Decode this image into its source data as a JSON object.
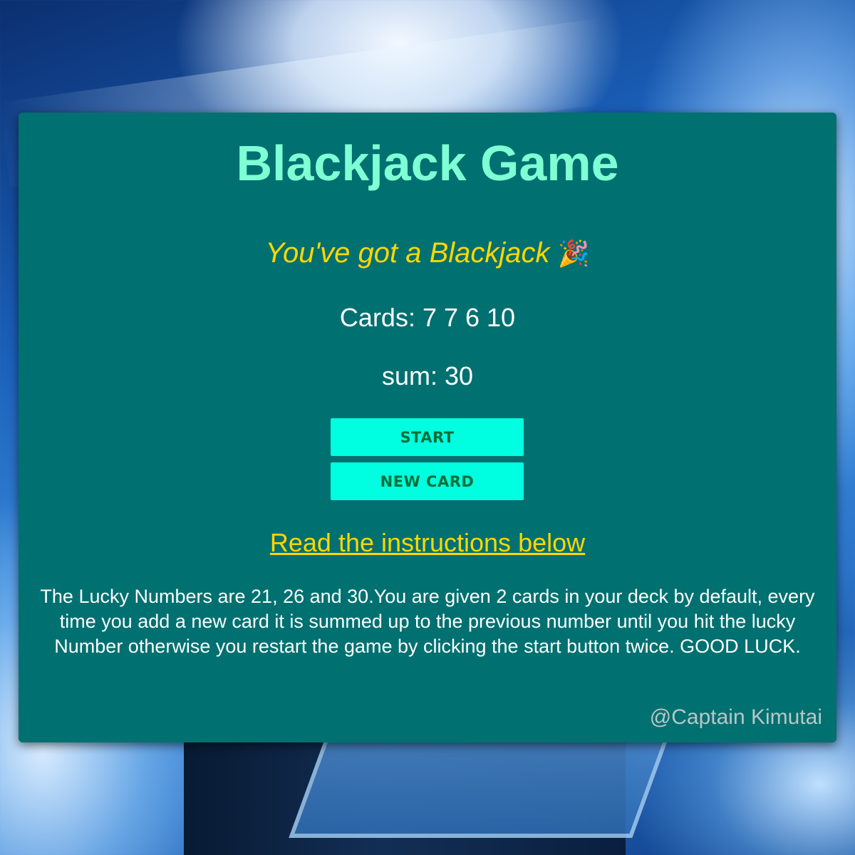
{
  "game": {
    "title": "Blackjack Game",
    "message": "You've got a Blackjack",
    "message_emoji": "🎉",
    "cards_text": "Cards: 7 7 6 10",
    "sum_text": "sum: 30"
  },
  "buttons": {
    "start_label": "START",
    "new_card_label": "NEW CARD"
  },
  "instructions": {
    "link_text": "Read the instructions below",
    "body": "The Lucky Numbers are 21, 26 and 30.You are given 2 cards in your deck by default, every time you add a new card it is summed up to the previous number until you hit the lucky Number otherwise you restart the game by clicking the start button twice. GOOD LUCK."
  },
  "footer": {
    "credit": "@Captain Kimutai"
  },
  "colors": {
    "panel": "#007070",
    "title": "#7fffd4",
    "accent": "#ffd700",
    "button": "#00ffe0",
    "button_text": "#016f3a"
  }
}
